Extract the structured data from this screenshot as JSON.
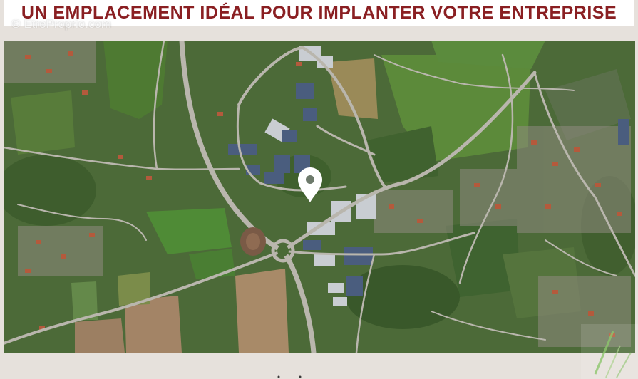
{
  "header": {
    "title": "UN EMPLACEMENT IDÉAL POUR IMPLANTER VOTRE ENTREPRISE"
  },
  "watermark": {
    "text": "© EtreProprio.com"
  },
  "map": {
    "view": "satellite",
    "marker_icon": "map-pin-icon"
  },
  "colors": {
    "title": "#8a1f22",
    "background": "#e6e1dc",
    "header_background": "#ffffff",
    "marker": "#ffffff"
  }
}
